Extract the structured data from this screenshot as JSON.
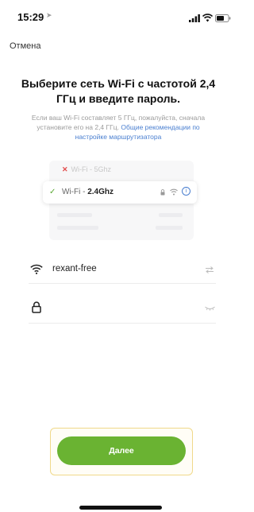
{
  "status_bar": {
    "time": "15:29",
    "location_arrow": "➤"
  },
  "nav": {
    "cancel_label": "Отмена"
  },
  "title": "Выберите сеть Wi-Fi с частотой 2,4 ГГц и введите пароль.",
  "hint": {
    "text": "Если ваш Wi-Fi составляет 5 ГГц, пожалуйста, сначала установите его на 2,4 ГГц.",
    "link": "Общие рекомендации по настройке маршрутизатора"
  },
  "illustration": {
    "row_5g": {
      "mark": "✕",
      "label": "Wi-Fi - 5Ghz"
    },
    "row_24g": {
      "mark": "✓",
      "label_prefix": "Wi-Fi - ",
      "label_strong": "2.4Ghz",
      "info_glyph": "i"
    }
  },
  "form": {
    "ssid_value": "rexant-free",
    "password_value": ""
  },
  "next_button_label": "Далее",
  "colors": {
    "accent_green": "#6ab332",
    "link_blue": "#4a7fd0",
    "error_red": "#e24b4b"
  },
  "icons": {
    "ssid_field": "wifi-icon",
    "password_field": "lock-icon",
    "switch_network": "switch-arrows-icon",
    "password_visibility": "eye-closed-icon"
  }
}
